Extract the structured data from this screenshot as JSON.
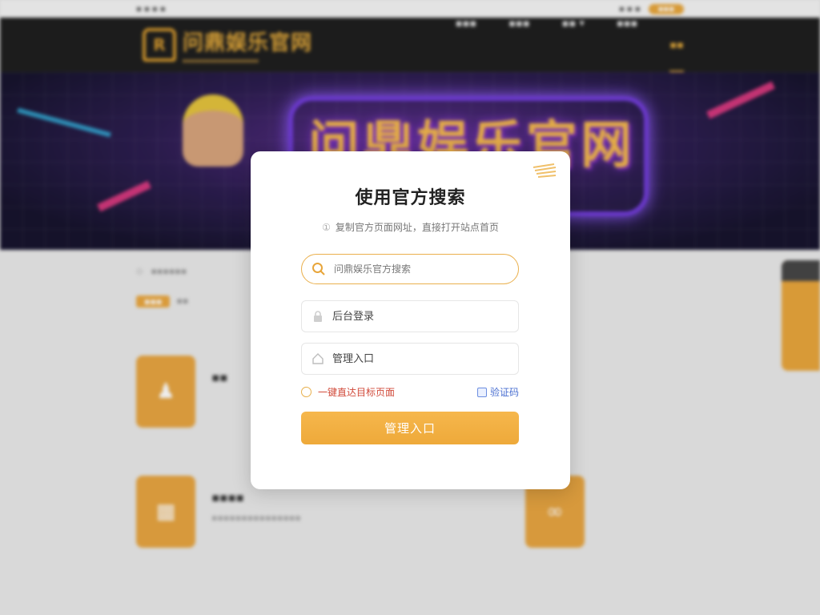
{
  "background": {
    "site_title": "问鼎娱乐官网",
    "hero_title": "问鼎娱乐官网"
  },
  "modal": {
    "title": "使用官方搜索",
    "description": "复制官方页面网址，直接打开站点首页",
    "search": {
      "placeholder": "问鼎娱乐官方搜索"
    },
    "field_admin_login": {
      "placeholder": "后台登录"
    },
    "field_admin_entry": {
      "placeholder": "管理入口"
    },
    "option_direct": "一键直达目标页面",
    "option_verify": "验证码",
    "submit_label": "管理入口"
  },
  "colors": {
    "accent": "#eea93a",
    "link_red": "#d14a3a",
    "link_blue": "#4a6fd1"
  },
  "icons": {
    "search": "search-icon",
    "lock": "lock-icon",
    "home": "home-icon",
    "info": "info-icon"
  }
}
